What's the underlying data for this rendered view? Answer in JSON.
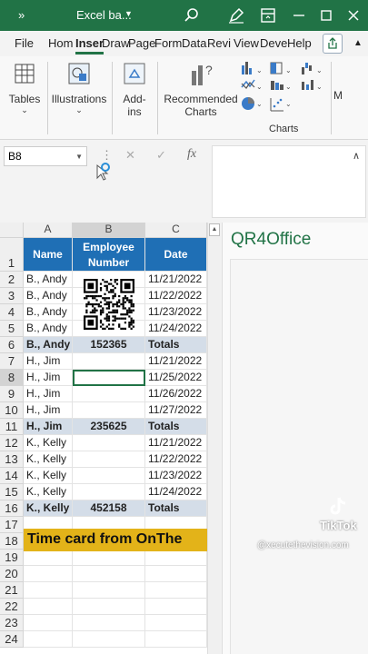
{
  "titlebar": {
    "chevron": "»",
    "title": "Excel ba...",
    "accent": "#217346"
  },
  "tabs": [
    "File",
    "Hom",
    "Inser",
    "Draw",
    "Page",
    "Form",
    "Data",
    "Revi",
    "View",
    "Deve",
    "Help"
  ],
  "active_tab": "Inser",
  "ribbon": {
    "groups": [
      {
        "label": "Tables",
        "icon": "table-icon"
      },
      {
        "label": "Illustrations",
        "icon": "illustrations-icon"
      },
      {
        "label": "Add-ins",
        "icon": "addins-icon",
        "label_line1": "Add-",
        "label_line2": "ins"
      },
      {
        "label": "Recommended Charts",
        "icon": "recommended-charts-icon",
        "label_line1": "Recommended",
        "label_line2": "Charts"
      }
    ],
    "charts_group_label": "Charts",
    "more_label": "M"
  },
  "formula_bar": {
    "name_box": "B8",
    "fx": "fx",
    "cancel": "✕",
    "enter": "✓",
    "value": ""
  },
  "columns": [
    "A",
    "B",
    "C"
  ],
  "rows": [
    "1",
    "2",
    "3",
    "4",
    "5",
    "6",
    "7",
    "8",
    "9",
    "10",
    "11",
    "12",
    "13",
    "14",
    "15",
    "16",
    "17",
    "18",
    "19",
    "20",
    "21",
    "22",
    "23",
    "24"
  ],
  "header": {
    "name": "Name",
    "employee_line1": "Employee",
    "employee_line2": "Number",
    "date": "Date"
  },
  "table_rows": [
    {
      "a": "B., Andy",
      "b": "",
      "c": "11/21/2022"
    },
    {
      "a": "B., Andy",
      "b": "",
      "c": "11/22/2022"
    },
    {
      "a": "B., Andy",
      "b": "",
      "c": "11/23/2022"
    },
    {
      "a": "B., Andy",
      "b": "",
      "c": "11/24/2022"
    },
    {
      "a": "B., Andy",
      "b": "152365",
      "c": "Totals",
      "total": true
    },
    {
      "a": "H., Jim",
      "b": "",
      "c": "11/21/2022"
    },
    {
      "a": "H., Jim",
      "b": "",
      "c": "11/25/2022"
    },
    {
      "a": "H., Jim",
      "b": "",
      "c": "11/26/2022"
    },
    {
      "a": "H., Jim",
      "b": "",
      "c": "11/27/2022"
    },
    {
      "a": "H., Jim",
      "b": "235625",
      "c": "Totals",
      "total": true
    },
    {
      "a": "K., Kelly",
      "b": "",
      "c": "11/21/2022"
    },
    {
      "a": "K., Kelly",
      "b": "",
      "c": "11/22/2022"
    },
    {
      "a": "K., Kelly",
      "b": "",
      "c": "11/23/2022"
    },
    {
      "a": "K., Kelly",
      "b": "",
      "c": "11/24/2022"
    },
    {
      "a": "K., Kelly",
      "b": "452158",
      "c": "Totals",
      "total": true
    }
  ],
  "banner_text": "Time card from OnThe",
  "header_color": "#1f6fb5",
  "total_color": "#d4dde8",
  "banner_color": "#e3b319",
  "side_pane": {
    "title": "QR4Office"
  },
  "watermark": {
    "brand": "TikTok",
    "handle": "@xecutethevision.com"
  }
}
